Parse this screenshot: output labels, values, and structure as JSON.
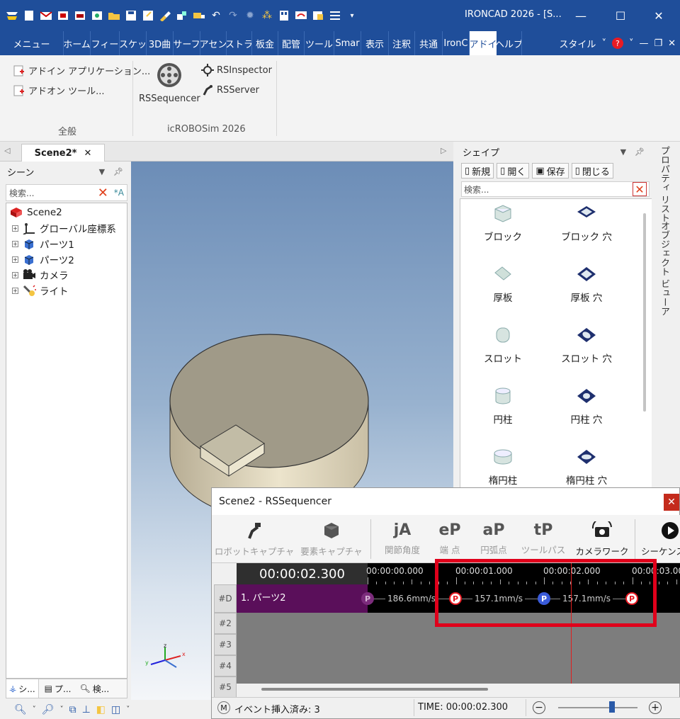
{
  "window": {
    "title": "IRONCAD 2026 - [S..."
  },
  "quick_access": [
    "app-logo-icon",
    "new-file-icon",
    "open-mail-icon",
    "export-icon",
    "print-icon",
    "scene-icon",
    "folder-icon",
    "save-icon",
    "save-as-icon",
    "paint-icon",
    "part-icon",
    "truck-icon",
    "undo-icon",
    "redo-icon",
    "gear-icon",
    "sparkle-icon",
    "layout-icon",
    "monitor-icon",
    "window-icon",
    "list-icon",
    "dropdown-icon"
  ],
  "ribbon_tabs": [
    "メニュー",
    "ホーム",
    "フィー",
    "スケッ",
    "3D曲",
    "サーフ",
    "アセン",
    "ストラ",
    "板金",
    "配管",
    "ツール",
    "Smar",
    "表示",
    "注釈",
    "共通",
    "IronC",
    "アドイ",
    "ヘルプ"
  ],
  "ribbon_right": {
    "style": "スタイル"
  },
  "ribbon": {
    "group1": {
      "label": "全般",
      "items": [
        "アドイン アプリケーション...",
        "アドオン ツール..."
      ]
    },
    "group2": {
      "label": "icROBOSim 2026",
      "big": "RSSequencer",
      "items": [
        "RSInspector",
        "RSServer"
      ]
    }
  },
  "doc_tab": {
    "label": "Scene2*"
  },
  "scene_panel": {
    "title": "シーン",
    "search_placeholder": "検索...",
    "tree": {
      "root": "Scene2",
      "children": [
        "グローバル座標系",
        "パーツ1",
        "パーツ2",
        "カメラ",
        "ライト"
      ]
    },
    "bottom_tabs": [
      "シ...",
      "プ...",
      "検..."
    ]
  },
  "shape_panel": {
    "title": "シェイプ",
    "toolbar": [
      "新規",
      "開く",
      "保存",
      "閉じる"
    ],
    "search_placeholder": "検索...",
    "shapes": [
      "ブロック",
      "ブロック 穴",
      "厚板",
      "厚板 穴",
      "スロット",
      "スロット 穴",
      "円柱",
      "円柱 穴",
      "楕円柱",
      "楕円柱 穴"
    ]
  },
  "side_tabs": [
    "プロパティ リスト",
    "オブジェクト ビューア"
  ],
  "sequencer": {
    "title": "Scene2 - RSSequencer",
    "toolbar": {
      "robot_capture": "ロボットキャプチャ",
      "element_capture": "要素キャプチャ",
      "joint_angle": "関節角度",
      "end_point": "端 点",
      "arc_point": "円弧点",
      "tool_path": "ツールパス",
      "camera_work": "カメラワーク",
      "sequence": "シーケンス"
    },
    "toolbar_glyphs": {
      "joint_angle": "jA",
      "end_point": "eP",
      "arc_point": "aP",
      "tool_path": "tP"
    },
    "current_time": "00:00:02.300",
    "ruler": [
      "00:00:00.000",
      "00:00:01.000",
      "00:00:02.000",
      "00:00:03.00"
    ],
    "rows": [
      "#D",
      "#2",
      "#3",
      "#4",
      "#5"
    ],
    "track": {
      "name": "1. パーツ2",
      "marker": "P",
      "speeds": [
        "186.6mm/s",
        "157.1mm/s",
        "157.1mm/s"
      ]
    },
    "status": {
      "mode": "M",
      "event": "イベント挿入済み: 3",
      "time": "TIME: 00:00:02.300"
    }
  },
  "colors": {
    "title_blue": "#1f4e9a",
    "track_purple": "#5a0f5a",
    "marker_red": "#e81b23",
    "marker_blue": "#3a5bd9",
    "highlight": "#e0001b"
  }
}
